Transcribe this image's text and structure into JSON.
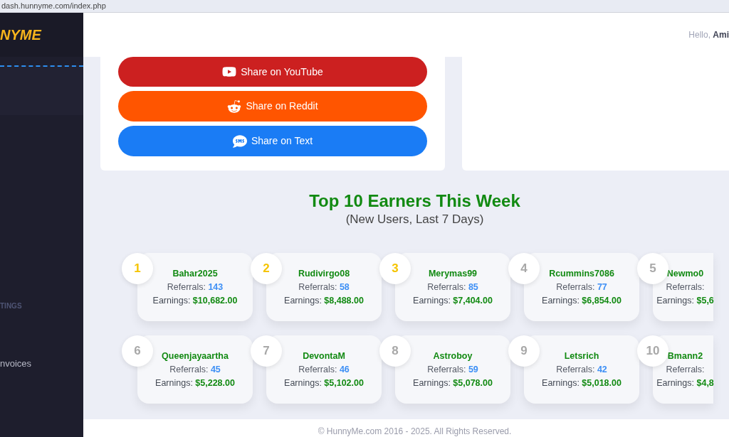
{
  "browser": {
    "url": "dash.hunnyme.com/index.php"
  },
  "sidebar": {
    "logo": "NYME",
    "section": "TINGS",
    "items": [
      {
        "label": "nvoices"
      }
    ]
  },
  "header": {
    "greeting": "Hello,",
    "user": "Ami"
  },
  "share_buttons": [
    {
      "kind": "youtube",
      "label": "Share on YouTube"
    },
    {
      "kind": "reddit",
      "label": "Share on Reddit"
    },
    {
      "kind": "sms",
      "label": "Share on Text"
    }
  ],
  "leaderboard": {
    "title": "Top 10 Earners This Week",
    "subtitle": "(New Users, Last 7 Days)",
    "entries": [
      {
        "rank": "1",
        "top": true,
        "name": "Bahar2025",
        "referrals_label": "Referrals:",
        "referrals": "143",
        "earnings_label": "Earnings:",
        "earnings": "$10,682.00"
      },
      {
        "rank": "2",
        "top": true,
        "name": "Rudivirgo08",
        "referrals_label": "Referrals:",
        "referrals": "58",
        "earnings_label": "Earnings:",
        "earnings": "$8,488.00"
      },
      {
        "rank": "3",
        "top": true,
        "name": "Merymas99",
        "referrals_label": "Referrals:",
        "referrals": "85",
        "earnings_label": "Earnings:",
        "earnings": "$7,404.00"
      },
      {
        "rank": "4",
        "top": false,
        "name": "Rcummins7086",
        "referrals_label": "Referrals:",
        "referrals": "77",
        "earnings_label": "Earnings:",
        "earnings": "$6,854.00"
      },
      {
        "rank": "5",
        "top": false,
        "name": "Newmo0",
        "referrals_label": "Referrals:",
        "earnings_label": "Earnings:",
        "earnings": "$5,6"
      },
      {
        "rank": "6",
        "top": false,
        "name": "Queenjayaartha",
        "referrals_label": "Referrals:",
        "referrals": "45",
        "earnings_label": "Earnings:",
        "earnings": "$5,228.00"
      },
      {
        "rank": "7",
        "top": false,
        "name": "DevontaM",
        "referrals_label": "Referrals:",
        "referrals": "46",
        "earnings_label": "Earnings:",
        "earnings": "$5,102.00"
      },
      {
        "rank": "8",
        "top": false,
        "name": "Astroboy",
        "referrals_label": "Referrals:",
        "referrals": "59",
        "earnings_label": "Earnings:",
        "earnings": "$5,078.00"
      },
      {
        "rank": "9",
        "top": false,
        "name": "Letsrich",
        "referrals_label": "Referrals:",
        "referrals": "42",
        "earnings_label": "Earnings:",
        "earnings": "$5,018.00"
      },
      {
        "rank": "10",
        "top": false,
        "name": "Bmann2",
        "referrals_label": "Referrals:",
        "earnings_label": "Earnings:",
        "earnings": "$4,8"
      }
    ]
  },
  "footer": {
    "text": "© HunnyMe.com 2016 - 2025. All Rights Reserved."
  }
}
